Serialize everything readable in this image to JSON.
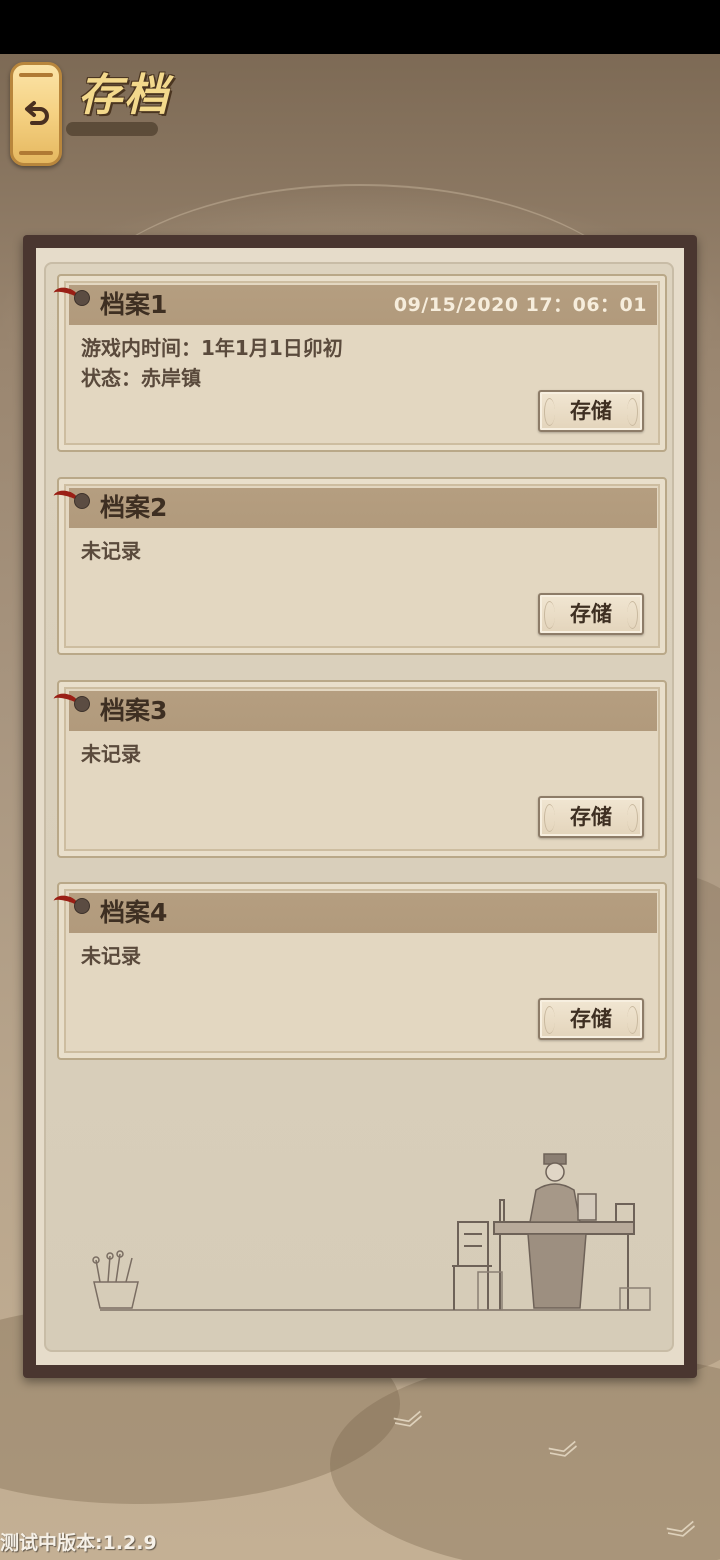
{
  "header": {
    "title": "存档"
  },
  "slots": [
    {
      "title": "档案1",
      "date": "09/15/2020  17：06：01",
      "lines": [
        "游戏内时间：1年1月1日卯初",
        "状态：赤岸镇"
      ],
      "save_label": "存储"
    },
    {
      "title": "档案2",
      "date": "",
      "lines": [
        "未记录"
      ],
      "save_label": "存储"
    },
    {
      "title": "档案3",
      "date": "",
      "lines": [
        "未记录"
      ],
      "save_label": "存储"
    },
    {
      "title": "档案4",
      "date": "",
      "lines": [
        "未记录"
      ],
      "save_label": "存储"
    }
  ],
  "footer": {
    "version": "测试中版本:1.2.9"
  },
  "icons": {
    "back": "back-arrow-icon",
    "pin": "pin-icon"
  },
  "colors": {
    "panel_frame": "#4a3630",
    "slot_header": "#b59e80",
    "title_gold": "#f3d98c",
    "ribbon_red": "#9a1f15"
  }
}
